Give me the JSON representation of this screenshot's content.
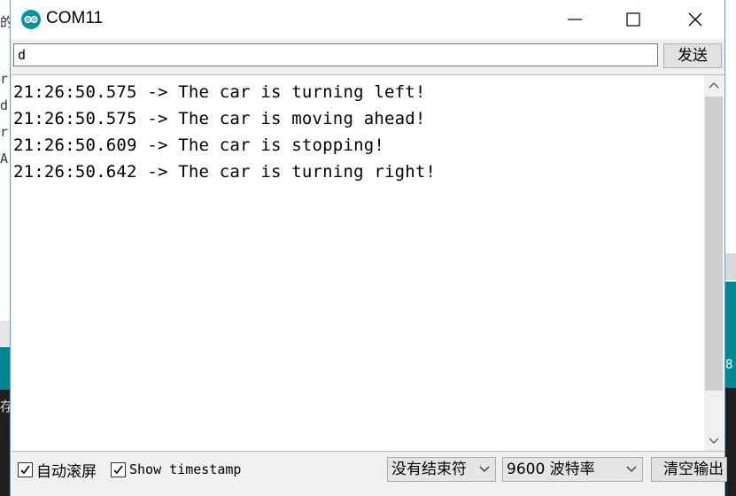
{
  "window": {
    "title": "COM11",
    "icon": "arduino-icon"
  },
  "background_window": {
    "left_glyphs": [
      "的",
      "r",
      "d",
      "r",
      "A",
      "存"
    ],
    "right_glyphs": [
      "8"
    ]
  },
  "input": {
    "value": "d",
    "send_label": "发送"
  },
  "output": {
    "lines": [
      "21:26:50.575 -> The car is turning left!",
      "21:26:50.575 -> The car is moving ahead!",
      "21:26:50.609 -> The car is stopping!",
      "21:26:50.642 -> The car is turning right!"
    ]
  },
  "status_bar": {
    "autoscroll": {
      "label": "自动滚屏",
      "checked": true
    },
    "timestamp": {
      "label": "Show timestamp",
      "checked": true
    },
    "line_ending": "没有结束符",
    "baud_rate": "9600 波特率",
    "clear_label": "清空输出"
  },
  "colors": {
    "accent": "#00979c",
    "window_border": "#5a9fd4"
  }
}
